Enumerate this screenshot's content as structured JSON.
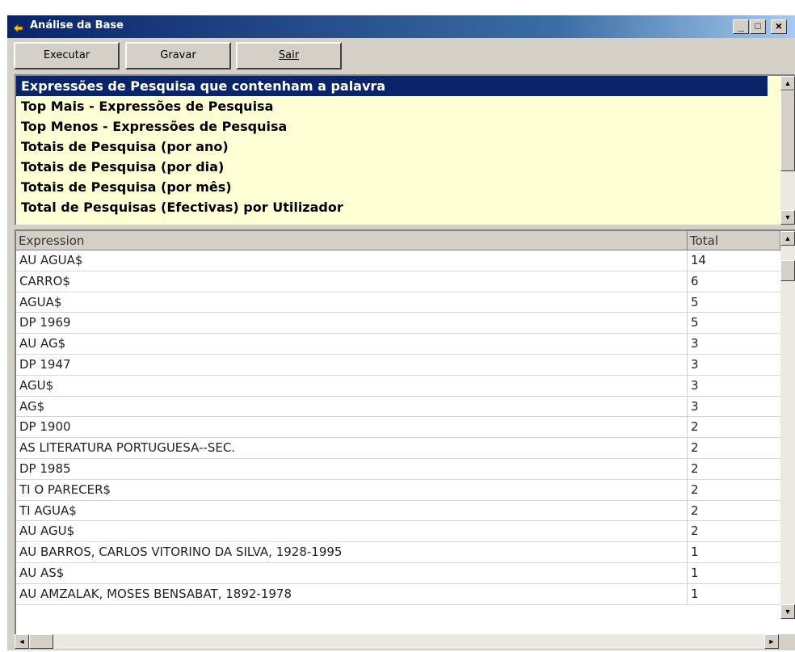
{
  "window": {
    "title": "Análise da Base",
    "icon": "app-arrow-icon",
    "controls": {
      "minimize": "_",
      "maximize": "□",
      "close": "×"
    }
  },
  "toolbar": {
    "execute_label": "Executar",
    "save_label": "Gravar",
    "exit_label": "Sair"
  },
  "queries": {
    "selected_index": 0,
    "items": [
      "Expressões de Pesquisa que contenham a palavra",
      "Top Mais - Expressões de Pesquisa",
      "Top Menos - Expressões de Pesquisa",
      "Totais de Pesquisa (por ano)",
      "Totais de Pesquisa (por dia)",
      "Totais de Pesquisa (por mês)",
      "Total de Pesquisas (Efectivas) por Utilizador"
    ]
  },
  "results": {
    "columns": [
      "Expression",
      "Total"
    ],
    "rows": [
      [
        "AU AGUA$",
        "14"
      ],
      [
        "CARRO$",
        "6"
      ],
      [
        "AGUA$",
        "5"
      ],
      [
        "DP 1969",
        "5"
      ],
      [
        "AU AG$",
        "3"
      ],
      [
        "DP 1947",
        "3"
      ],
      [
        "AGU$",
        "3"
      ],
      [
        "AG$",
        "3"
      ],
      [
        "DP 1900",
        "2"
      ],
      [
        "AS LITERATURA PORTUGUESA--SEC.",
        "2"
      ],
      [
        "DP 1985",
        "2"
      ],
      [
        "TI O PARECER$",
        "2"
      ],
      [
        "TI AGUA$",
        "2"
      ],
      [
        "AU AGU$",
        "2"
      ],
      [
        "AU BARROS, CARLOS VITORINO DA SILVA, 1928-1995",
        "1"
      ],
      [
        "AU AS$",
        "1"
      ],
      [
        "AU AMZALAK, MOSES BENSABAT, 1892-1978",
        "1"
      ]
    ]
  },
  "colors": {
    "titlebar_start": "#0a246a",
    "titlebar_end": "#a6caf0",
    "listbox_bg": "#ffffd5",
    "selection": "#0a246a",
    "face": "#d4d0c8"
  }
}
